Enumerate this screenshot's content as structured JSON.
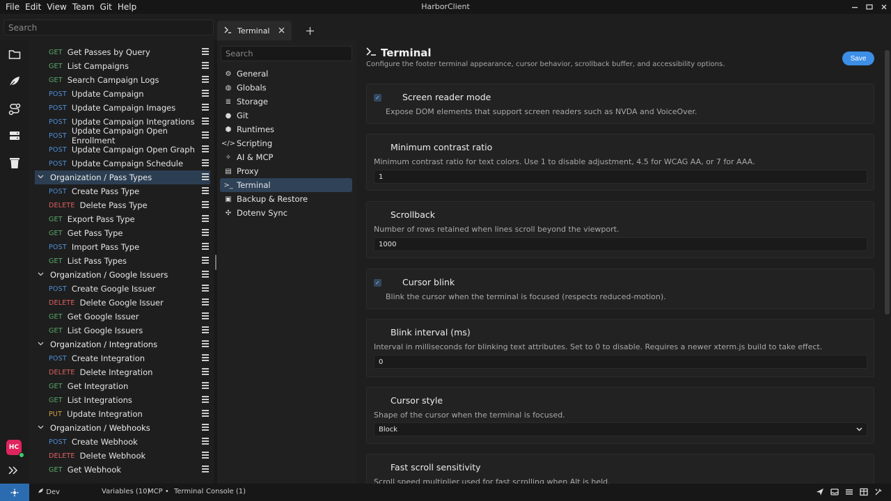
{
  "app": {
    "title": "HarborClient",
    "menu": [
      "File",
      "Edit",
      "View",
      "Team",
      "Git",
      "Help"
    ]
  },
  "top": {
    "search_placeholder": "Search",
    "tabs": [
      {
        "label": "Terminal",
        "icon": "terminal-icon"
      }
    ]
  },
  "tree": {
    "rows": [
      {
        "kind": "req",
        "method": "GET",
        "label": "Get Passes by Query"
      },
      {
        "kind": "req",
        "method": "GET",
        "label": "List Campaigns"
      },
      {
        "kind": "req",
        "method": "GET",
        "label": "Search Campaign Logs"
      },
      {
        "kind": "req",
        "method": "POST",
        "label": "Update Campaign"
      },
      {
        "kind": "req",
        "method": "POST",
        "label": "Update Campaign Images"
      },
      {
        "kind": "req",
        "method": "POST",
        "label": "Update Campaign Integrations"
      },
      {
        "kind": "req",
        "method": "POST",
        "label": "Update Campaign Open Enrollment"
      },
      {
        "kind": "req",
        "method": "POST",
        "label": "Update Campaign Open Graph"
      },
      {
        "kind": "req",
        "method": "POST",
        "label": "Update Campaign Schedule"
      },
      {
        "kind": "folder",
        "label": "Organization / Pass Types",
        "selected": true
      },
      {
        "kind": "req",
        "method": "POST",
        "label": "Create Pass Type"
      },
      {
        "kind": "req",
        "method": "DELETE",
        "label": "Delete Pass Type"
      },
      {
        "kind": "req",
        "method": "GET",
        "label": "Export Pass Type"
      },
      {
        "kind": "req",
        "method": "GET",
        "label": "Get Pass Type"
      },
      {
        "kind": "req",
        "method": "POST",
        "label": "Import Pass Type"
      },
      {
        "kind": "req",
        "method": "GET",
        "label": "List Pass Types"
      },
      {
        "kind": "folder",
        "label": "Organization / Google Issuers"
      },
      {
        "kind": "req",
        "method": "POST",
        "label": "Create Google Issuer"
      },
      {
        "kind": "req",
        "method": "DELETE",
        "label": "Delete Google Issuer"
      },
      {
        "kind": "req",
        "method": "GET",
        "label": "Get Google Issuer"
      },
      {
        "kind": "req",
        "method": "GET",
        "label": "List Google Issuers"
      },
      {
        "kind": "folder",
        "label": "Organization / Integrations"
      },
      {
        "kind": "req",
        "method": "POST",
        "label": "Create Integration"
      },
      {
        "kind": "req",
        "method": "DELETE",
        "label": "Delete Integration"
      },
      {
        "kind": "req",
        "method": "GET",
        "label": "Get Integration"
      },
      {
        "kind": "req",
        "method": "GET",
        "label": "List Integrations"
      },
      {
        "kind": "req",
        "method": "PUT",
        "label": "Update Integration"
      },
      {
        "kind": "folder",
        "label": "Organization / Webhooks"
      },
      {
        "kind": "req",
        "method": "POST",
        "label": "Create Webhook"
      },
      {
        "kind": "req",
        "method": "DELETE",
        "label": "Delete Webhook"
      },
      {
        "kind": "req",
        "method": "GET",
        "label": "Get Webhook"
      }
    ]
  },
  "settings_nav": {
    "search_placeholder": "Search",
    "items": [
      {
        "label": "General",
        "icon": "gear-icon",
        "glyph": "⚙"
      },
      {
        "label": "Globals",
        "icon": "globe-icon",
        "glyph": "◍"
      },
      {
        "label": "Storage",
        "icon": "database-icon",
        "glyph": "≣"
      },
      {
        "label": "Git",
        "icon": "github-icon",
        "glyph": "●"
      },
      {
        "label": "Runtimes",
        "icon": "cubes-icon",
        "glyph": "⬢"
      },
      {
        "label": "Scripting",
        "icon": "code-icon",
        "glyph": "</>"
      },
      {
        "label": "AI & MCP",
        "icon": "wand-icon",
        "glyph": "✧"
      },
      {
        "label": "Proxy",
        "icon": "server-icon",
        "glyph": "▤"
      },
      {
        "label": "Terminal",
        "icon": "terminal-icon",
        "glyph": ">_",
        "selected": true
      },
      {
        "label": "Backup & Restore",
        "icon": "floppy-icon",
        "glyph": "▣"
      },
      {
        "label": "Dotenv Sync",
        "icon": "puzzle-icon",
        "glyph": "✣"
      }
    ]
  },
  "main": {
    "title": "Terminal",
    "description": "Configure the footer terminal appearance, cursor behavior, scrollback buffer, and accessibility options.",
    "save_label": "Save",
    "settings": {
      "screen_reader": {
        "title": "Screen reader mode",
        "desc": "Expose DOM elements that support screen readers such as NVDA and VoiceOver.",
        "checked": true
      },
      "min_contrast": {
        "title": "Minimum contrast ratio",
        "desc": "Minimum contrast ratio for text colors. Use 1 to disable adjustment, 4.5 for WCAG AA, or 7 for AAA.",
        "value": "1"
      },
      "scrollback": {
        "title": "Scrollback",
        "desc": "Number of rows retained when lines scroll beyond the viewport.",
        "value": "1000"
      },
      "cursor_blink": {
        "title": "Cursor blink",
        "desc": "Blink the cursor when the terminal is focused (respects reduced-motion).",
        "checked": true
      },
      "blink_interval": {
        "title": "Blink interval (ms)",
        "desc": "Interval in milliseconds for blinking text attributes. Set to 0 to disable. Requires a newer xterm.js build to take effect.",
        "value": "0"
      },
      "cursor_style": {
        "title": "Cursor style",
        "desc": "Shape of the cursor when the terminal is focused.",
        "value": "Block"
      },
      "fast_scroll": {
        "title": "Fast scroll sensitivity",
        "desc": "Scroll speed multiplier used for fast scrolling when Alt is held."
      }
    }
  },
  "rail": {
    "avatar": "HC"
  },
  "status": {
    "env": "Dev",
    "variables": "Variables (10)",
    "mcp": "MCP •",
    "terminal": "Terminal",
    "console": "Console (1)"
  },
  "colors": {
    "accent": "#3c8ee6",
    "selected_bg": "#2c3e52",
    "avatar": "#e0245e"
  }
}
